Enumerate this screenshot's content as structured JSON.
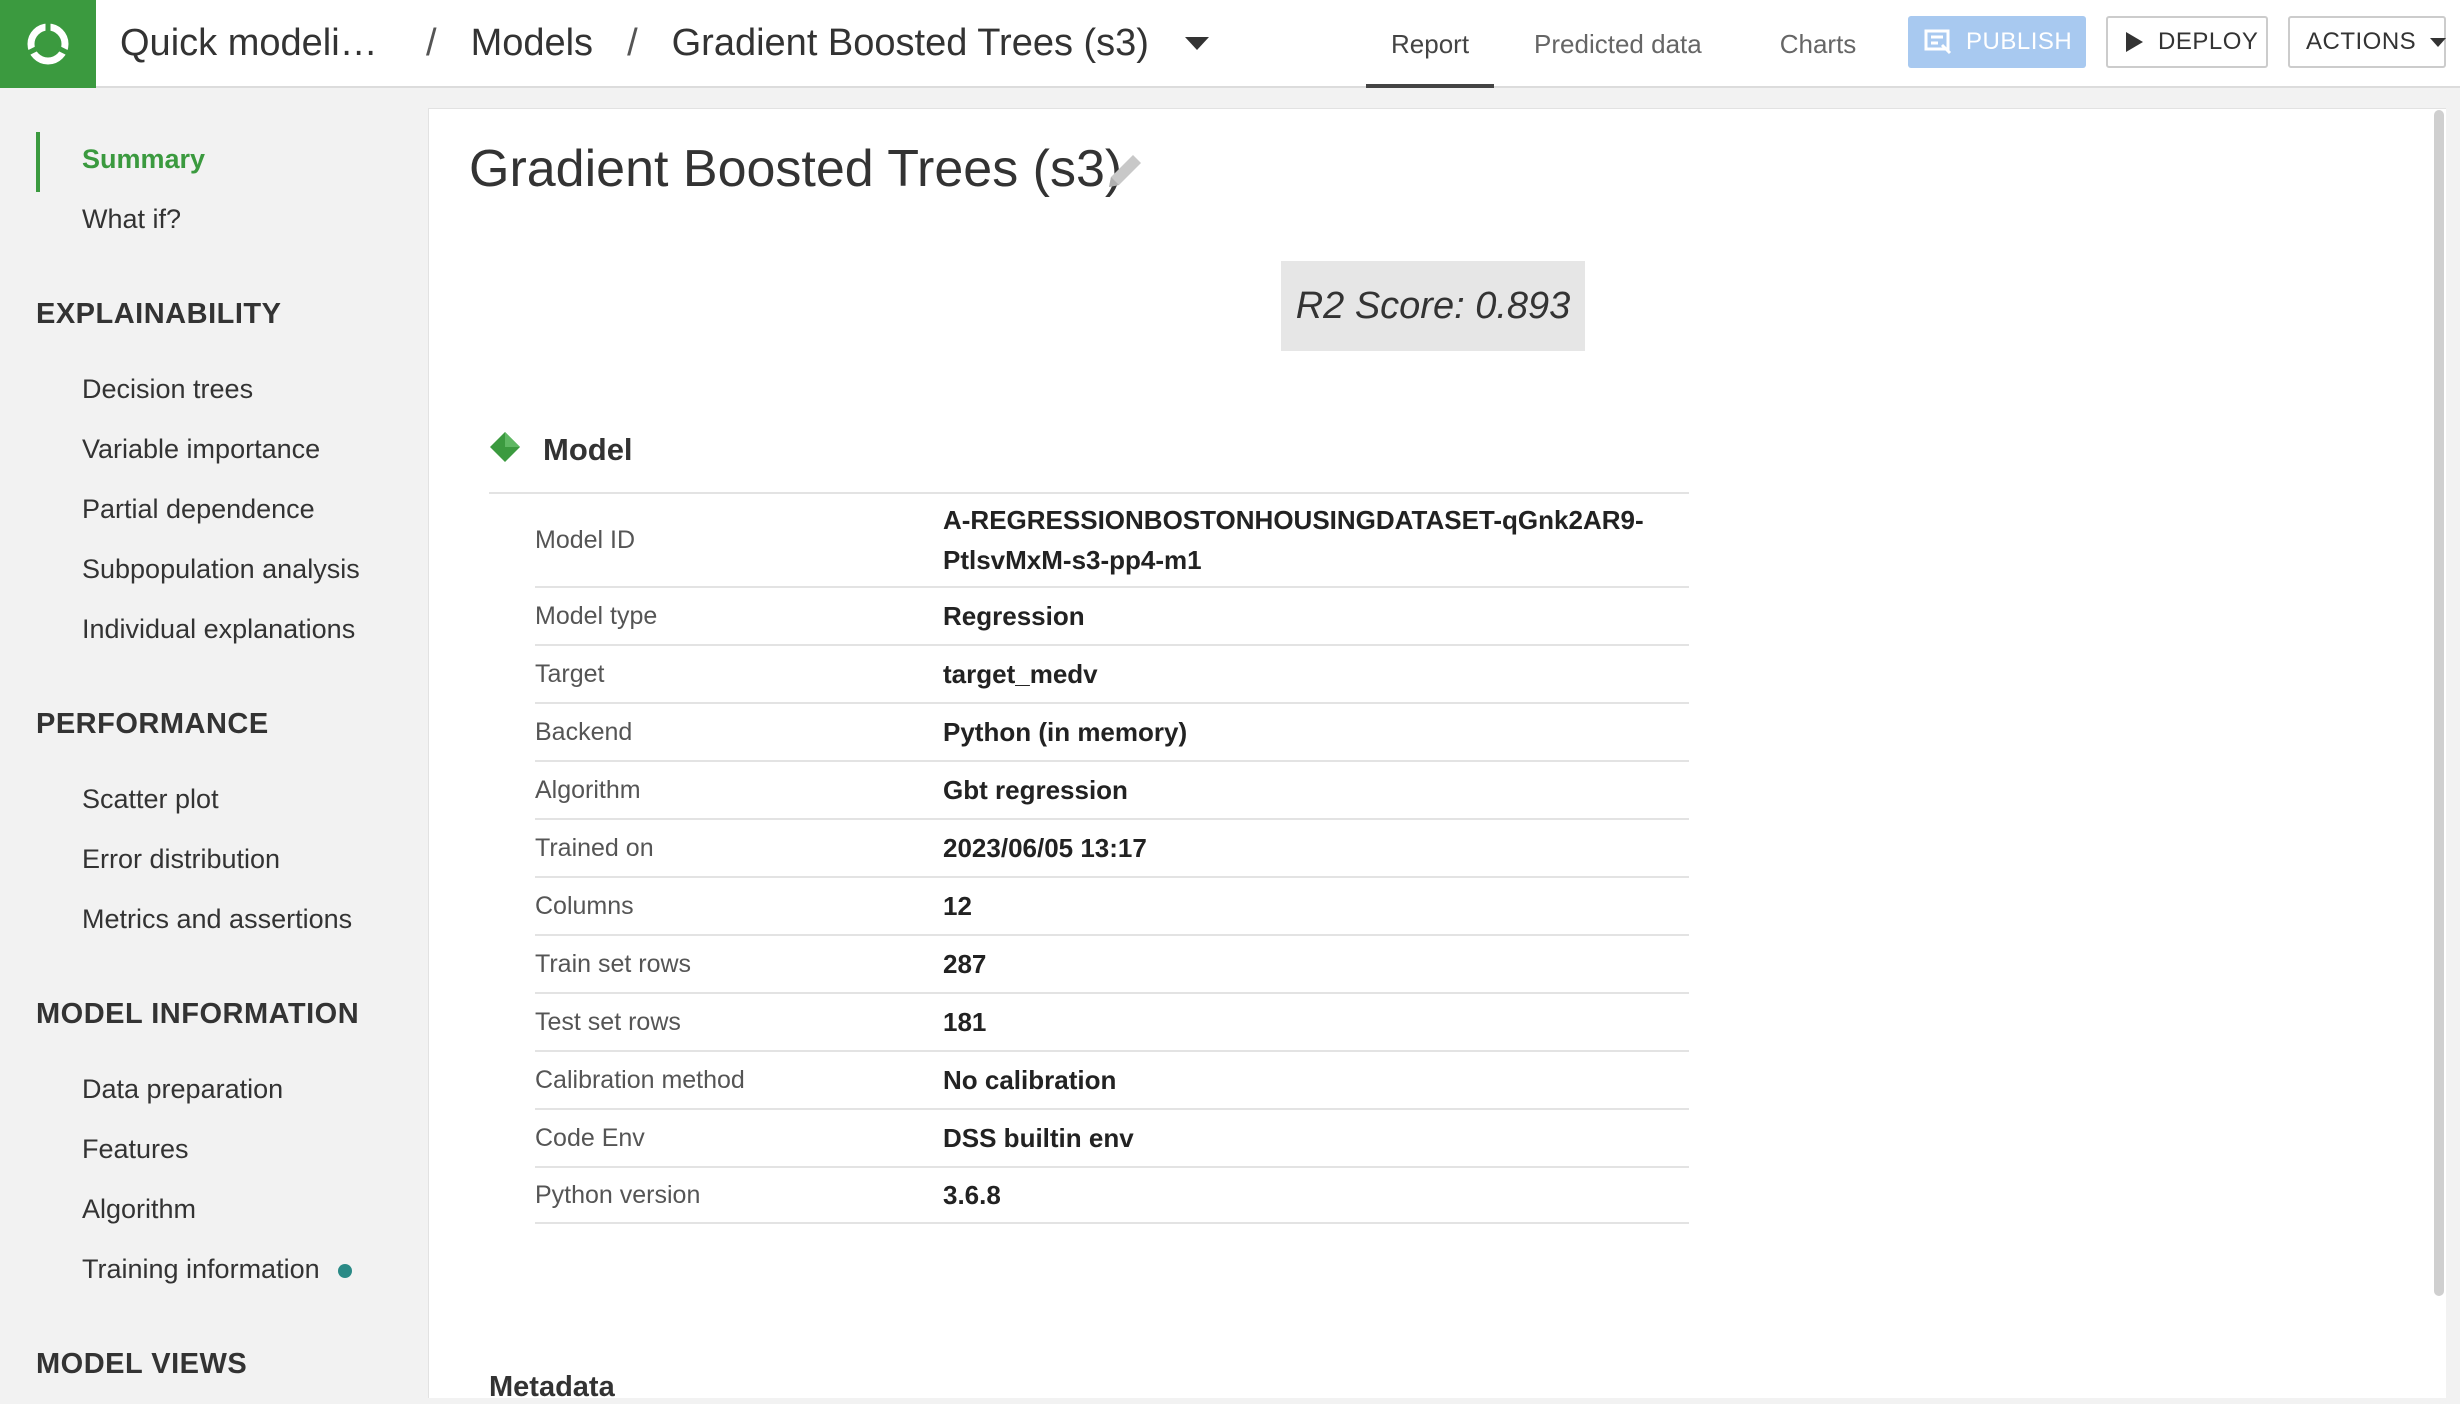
{
  "header": {
    "breadcrumb": [
      "Quick modeling of target_medv on regression_boston_housing_dataset",
      "Models",
      "Gradient Boosted Trees (s3)"
    ],
    "tabs": [
      "Report",
      "Predicted data",
      "Charts"
    ],
    "buttons": {
      "publish": "PUBLISH",
      "deploy": "DEPLOY",
      "actions": "ACTIONS"
    }
  },
  "sidebar": {
    "top": [
      "Summary",
      "What if?"
    ],
    "sections": [
      {
        "title": "EXPLAINABILITY",
        "items": [
          "Decision trees",
          "Variable importance",
          "Partial dependence",
          "Subpopulation analysis",
          "Individual explanations"
        ]
      },
      {
        "title": "PERFORMANCE",
        "items": [
          "Scatter plot",
          "Error distribution",
          "Metrics and assertions"
        ]
      },
      {
        "title": "MODEL INFORMATION",
        "items": [
          "Data preparation",
          "Features",
          "Algorithm",
          "Training information"
        ]
      },
      {
        "title": "MODEL VIEWS",
        "items": []
      }
    ]
  },
  "main": {
    "title": "Gradient Boosted Trees (s3)",
    "score": "R2 Score: 0.893",
    "model_section": "Model",
    "rows": [
      {
        "k": "Model ID",
        "v": "A-REGRESSIONBOSTONHOUSINGDATASET-qGnk2AR9-PtlsvMxM-s3-pp4-m1"
      },
      {
        "k": "Model type",
        "v": "Regression"
      },
      {
        "k": "Target",
        "v": "target_medv"
      },
      {
        "k": "Backend",
        "v": "Python (in memory)"
      },
      {
        "k": "Algorithm",
        "v": "Gbt regression"
      },
      {
        "k": "Trained on",
        "v": "2023/06/05 13:17"
      },
      {
        "k": "Columns",
        "v": "12"
      },
      {
        "k": "Train set rows",
        "v": "287"
      },
      {
        "k": "Test set rows",
        "v": "181"
      },
      {
        "k": "Calibration method",
        "v": "No calibration"
      },
      {
        "k": "Code Env",
        "v": "DSS builtin env"
      },
      {
        "k": "Python version",
        "v": "3.6.8"
      }
    ],
    "metadata_label": "Metadata"
  },
  "colors": {
    "brand": "#3b9a3f",
    "publish": "#a8c9f0",
    "dot": "#2a8a86"
  }
}
